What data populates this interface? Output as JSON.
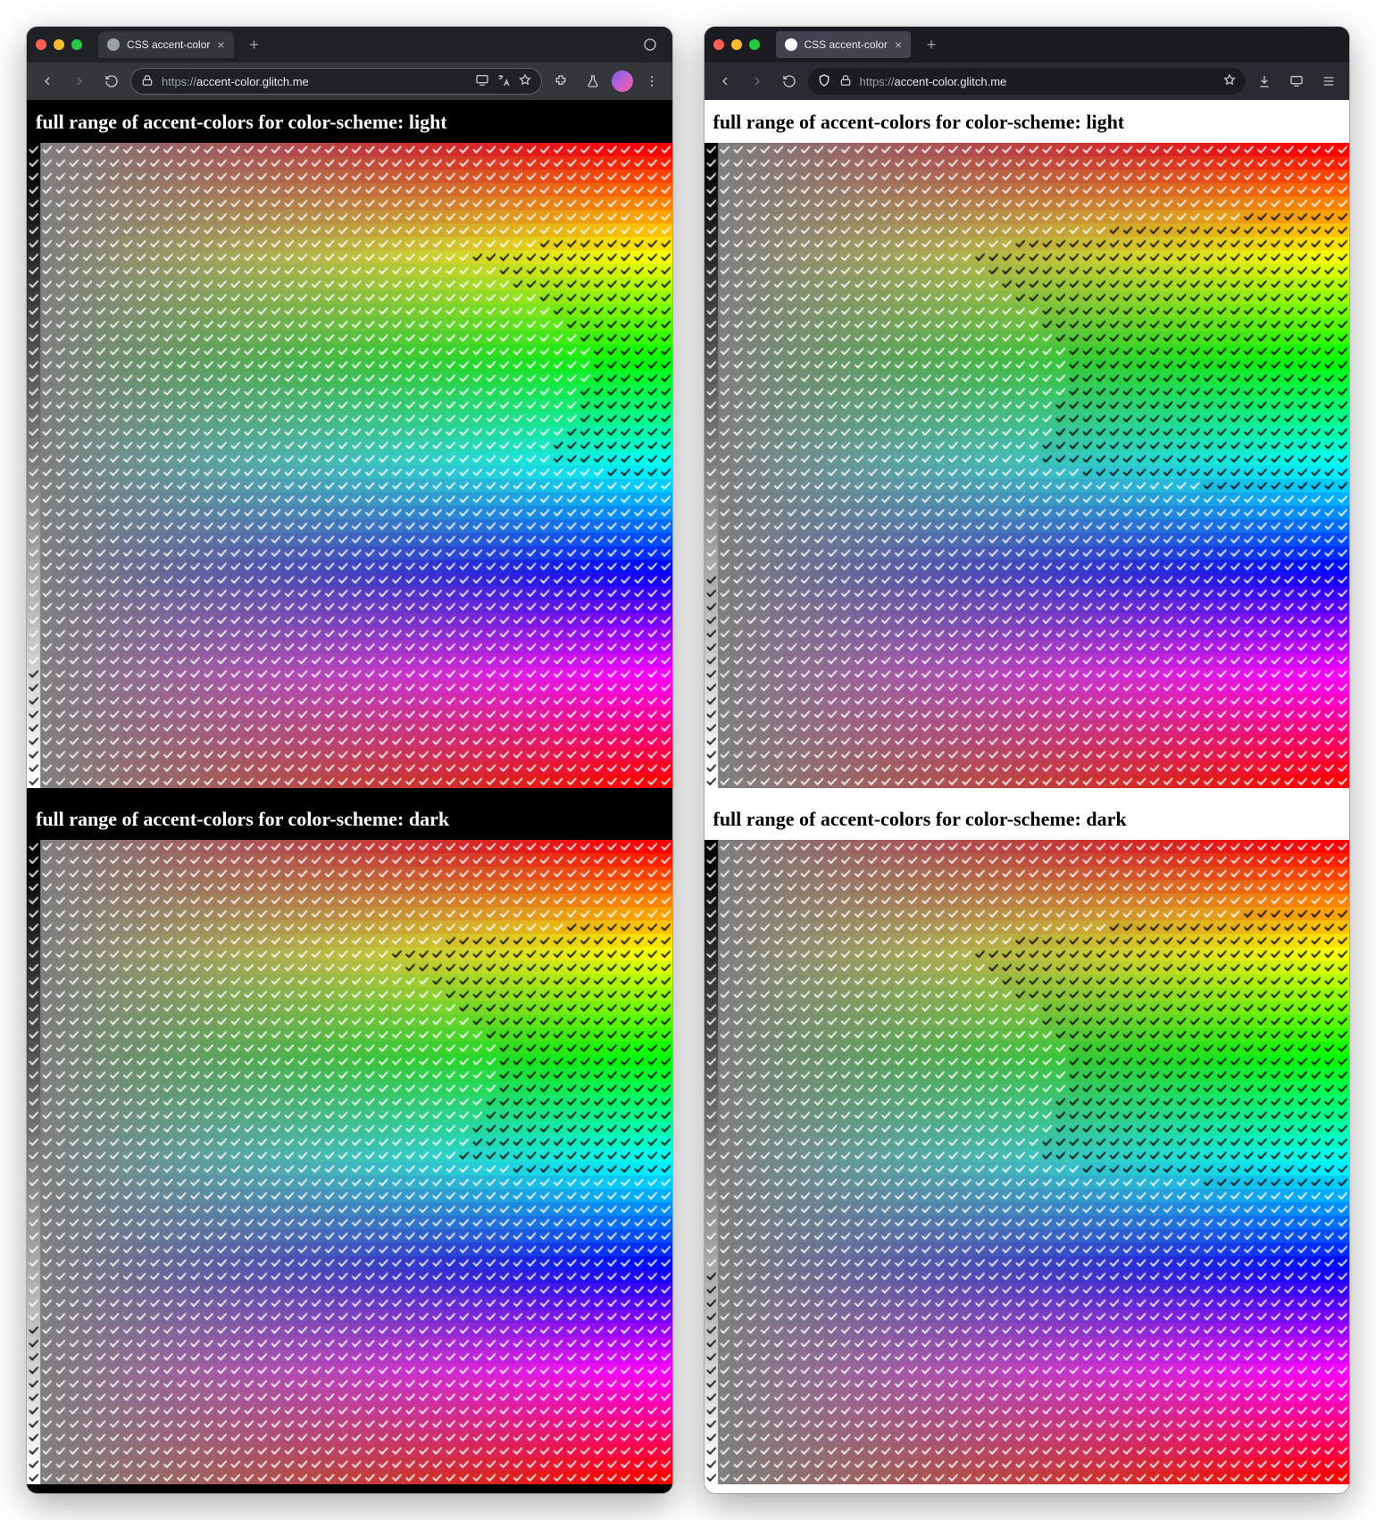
{
  "tab_title": "CSS accent-color",
  "url_display": "accent-color.glitch.me",
  "url_full": "https://accent-color.glitch.me",
  "heading_light": "full range of accent-colors for color-scheme: light",
  "heading_dark": "full range of accent-colors for color-scheme: dark",
  "grid": {
    "cols": 48,
    "rows": 48,
    "cell": 14
  },
  "luminance_check_threshold": {
    "chrome": 0.62,
    "firefox": 0.42
  },
  "chrome_dark_shift": -0.1,
  "icons": {
    "back": "back-icon",
    "fwd": "forward-icon",
    "reload": "reload-icon",
    "lock": "lock-icon",
    "star": "star-icon",
    "ext": "extensions-icon",
    "menu": "menu-icon",
    "shield": "shield-icon",
    "screen": "responsive-icon",
    "translate": "translate-icon",
    "flask": "experiments-icon"
  }
}
